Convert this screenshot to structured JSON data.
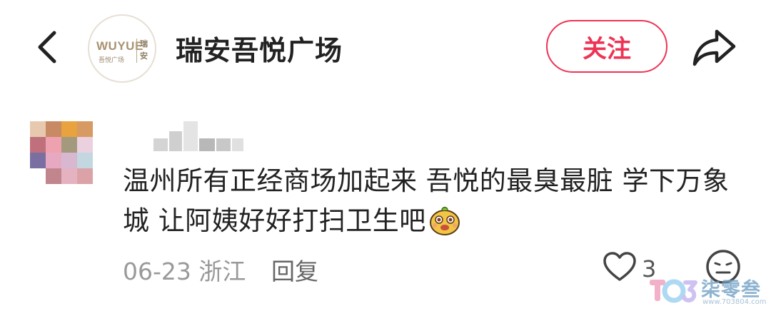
{
  "header": {
    "account_name": "瑞安吾悦广场",
    "follow_label": "关注",
    "logo": {
      "brand": "WUYUE",
      "sub": "吾悦广场",
      "city": "瑞安"
    }
  },
  "comment": {
    "text": "温州所有正经商场加起来 吾悦的最臭最脏 学下万象城 让阿姨好好打扫卫生吧",
    "emoji": "smiling-mascot-emoji",
    "date_location": "06-23 浙江",
    "reply_label": "回复",
    "like_count": "3",
    "liked": false
  },
  "watermark": {
    "name": "柒零叁",
    "url": "www.703804.com"
  },
  "colors": {
    "accent": "#ee3355",
    "text": "#222222",
    "meta": "#999999"
  }
}
